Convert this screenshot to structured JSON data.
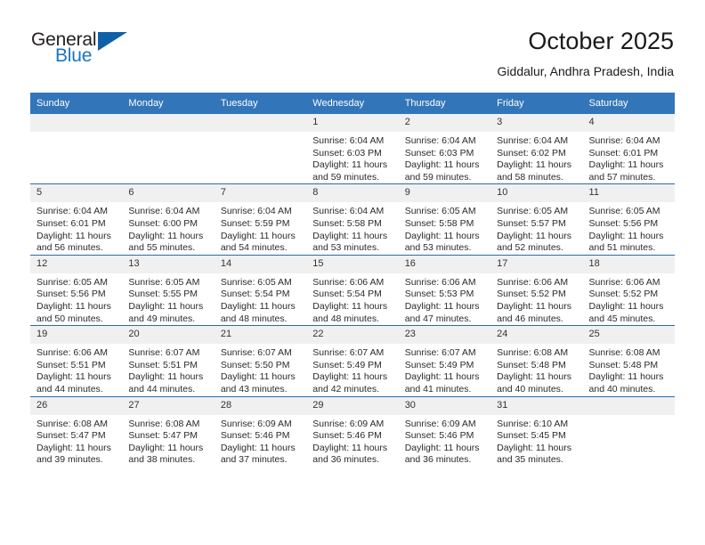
{
  "brand": {
    "name_top": "General",
    "name_bottom": "Blue",
    "color_dark": "#231f20",
    "color_blue": "#1c75bc",
    "triangle_color": "#1060a8"
  },
  "header": {
    "title": "October 2025",
    "subtitle": "Giddalur, Andhra Pradesh, India"
  },
  "theme": {
    "header_row_bg": "#3275b9",
    "week_rule": "#2d6ca8",
    "daynum_bg": "#f0f0f0"
  },
  "weekdays": [
    "Sunday",
    "Monday",
    "Tuesday",
    "Wednesday",
    "Thursday",
    "Friday",
    "Saturday"
  ],
  "weeks": [
    [
      {
        "day": "",
        "blank": true,
        "sunrise": "",
        "sunset": "",
        "daylight1": "",
        "daylight2": ""
      },
      {
        "day": "",
        "blank": true,
        "sunrise": "",
        "sunset": "",
        "daylight1": "",
        "daylight2": ""
      },
      {
        "day": "",
        "blank": true,
        "sunrise": "",
        "sunset": "",
        "daylight1": "",
        "daylight2": ""
      },
      {
        "day": "1",
        "sunrise": "Sunrise: 6:04 AM",
        "sunset": "Sunset: 6:03 PM",
        "daylight1": "Daylight: 11 hours",
        "daylight2": "and 59 minutes."
      },
      {
        "day": "2",
        "sunrise": "Sunrise: 6:04 AM",
        "sunset": "Sunset: 6:03 PM",
        "daylight1": "Daylight: 11 hours",
        "daylight2": "and 59 minutes."
      },
      {
        "day": "3",
        "sunrise": "Sunrise: 6:04 AM",
        "sunset": "Sunset: 6:02 PM",
        "daylight1": "Daylight: 11 hours",
        "daylight2": "and 58 minutes."
      },
      {
        "day": "4",
        "sunrise": "Sunrise: 6:04 AM",
        "sunset": "Sunset: 6:01 PM",
        "daylight1": "Daylight: 11 hours",
        "daylight2": "and 57 minutes."
      }
    ],
    [
      {
        "day": "5",
        "sunrise": "Sunrise: 6:04 AM",
        "sunset": "Sunset: 6:01 PM",
        "daylight1": "Daylight: 11 hours",
        "daylight2": "and 56 minutes."
      },
      {
        "day": "6",
        "sunrise": "Sunrise: 6:04 AM",
        "sunset": "Sunset: 6:00 PM",
        "daylight1": "Daylight: 11 hours",
        "daylight2": "and 55 minutes."
      },
      {
        "day": "7",
        "sunrise": "Sunrise: 6:04 AM",
        "sunset": "Sunset: 5:59 PM",
        "daylight1": "Daylight: 11 hours",
        "daylight2": "and 54 minutes."
      },
      {
        "day": "8",
        "sunrise": "Sunrise: 6:04 AM",
        "sunset": "Sunset: 5:58 PM",
        "daylight1": "Daylight: 11 hours",
        "daylight2": "and 53 minutes."
      },
      {
        "day": "9",
        "sunrise": "Sunrise: 6:05 AM",
        "sunset": "Sunset: 5:58 PM",
        "daylight1": "Daylight: 11 hours",
        "daylight2": "and 53 minutes."
      },
      {
        "day": "10",
        "sunrise": "Sunrise: 6:05 AM",
        "sunset": "Sunset: 5:57 PM",
        "daylight1": "Daylight: 11 hours",
        "daylight2": "and 52 minutes."
      },
      {
        "day": "11",
        "sunrise": "Sunrise: 6:05 AM",
        "sunset": "Sunset: 5:56 PM",
        "daylight1": "Daylight: 11 hours",
        "daylight2": "and 51 minutes."
      }
    ],
    [
      {
        "day": "12",
        "sunrise": "Sunrise: 6:05 AM",
        "sunset": "Sunset: 5:56 PM",
        "daylight1": "Daylight: 11 hours",
        "daylight2": "and 50 minutes."
      },
      {
        "day": "13",
        "sunrise": "Sunrise: 6:05 AM",
        "sunset": "Sunset: 5:55 PM",
        "daylight1": "Daylight: 11 hours",
        "daylight2": "and 49 minutes."
      },
      {
        "day": "14",
        "sunrise": "Sunrise: 6:05 AM",
        "sunset": "Sunset: 5:54 PM",
        "daylight1": "Daylight: 11 hours",
        "daylight2": "and 48 minutes."
      },
      {
        "day": "15",
        "sunrise": "Sunrise: 6:06 AM",
        "sunset": "Sunset: 5:54 PM",
        "daylight1": "Daylight: 11 hours",
        "daylight2": "and 48 minutes."
      },
      {
        "day": "16",
        "sunrise": "Sunrise: 6:06 AM",
        "sunset": "Sunset: 5:53 PM",
        "daylight1": "Daylight: 11 hours",
        "daylight2": "and 47 minutes."
      },
      {
        "day": "17",
        "sunrise": "Sunrise: 6:06 AM",
        "sunset": "Sunset: 5:52 PM",
        "daylight1": "Daylight: 11 hours",
        "daylight2": "and 46 minutes."
      },
      {
        "day": "18",
        "sunrise": "Sunrise: 6:06 AM",
        "sunset": "Sunset: 5:52 PM",
        "daylight1": "Daylight: 11 hours",
        "daylight2": "and 45 minutes."
      }
    ],
    [
      {
        "day": "19",
        "sunrise": "Sunrise: 6:06 AM",
        "sunset": "Sunset: 5:51 PM",
        "daylight1": "Daylight: 11 hours",
        "daylight2": "and 44 minutes."
      },
      {
        "day": "20",
        "sunrise": "Sunrise: 6:07 AM",
        "sunset": "Sunset: 5:51 PM",
        "daylight1": "Daylight: 11 hours",
        "daylight2": "and 44 minutes."
      },
      {
        "day": "21",
        "sunrise": "Sunrise: 6:07 AM",
        "sunset": "Sunset: 5:50 PM",
        "daylight1": "Daylight: 11 hours",
        "daylight2": "and 43 minutes."
      },
      {
        "day": "22",
        "sunrise": "Sunrise: 6:07 AM",
        "sunset": "Sunset: 5:49 PM",
        "daylight1": "Daylight: 11 hours",
        "daylight2": "and 42 minutes."
      },
      {
        "day": "23",
        "sunrise": "Sunrise: 6:07 AM",
        "sunset": "Sunset: 5:49 PM",
        "daylight1": "Daylight: 11 hours",
        "daylight2": "and 41 minutes."
      },
      {
        "day": "24",
        "sunrise": "Sunrise: 6:08 AM",
        "sunset": "Sunset: 5:48 PM",
        "daylight1": "Daylight: 11 hours",
        "daylight2": "and 40 minutes."
      },
      {
        "day": "25",
        "sunrise": "Sunrise: 6:08 AM",
        "sunset": "Sunset: 5:48 PM",
        "daylight1": "Daylight: 11 hours",
        "daylight2": "and 40 minutes."
      }
    ],
    [
      {
        "day": "26",
        "sunrise": "Sunrise: 6:08 AM",
        "sunset": "Sunset: 5:47 PM",
        "daylight1": "Daylight: 11 hours",
        "daylight2": "and 39 minutes."
      },
      {
        "day": "27",
        "sunrise": "Sunrise: 6:08 AM",
        "sunset": "Sunset: 5:47 PM",
        "daylight1": "Daylight: 11 hours",
        "daylight2": "and 38 minutes."
      },
      {
        "day": "28",
        "sunrise": "Sunrise: 6:09 AM",
        "sunset": "Sunset: 5:46 PM",
        "daylight1": "Daylight: 11 hours",
        "daylight2": "and 37 minutes."
      },
      {
        "day": "29",
        "sunrise": "Sunrise: 6:09 AM",
        "sunset": "Sunset: 5:46 PM",
        "daylight1": "Daylight: 11 hours",
        "daylight2": "and 36 minutes."
      },
      {
        "day": "30",
        "sunrise": "Sunrise: 6:09 AM",
        "sunset": "Sunset: 5:46 PM",
        "daylight1": "Daylight: 11 hours",
        "daylight2": "and 36 minutes."
      },
      {
        "day": "31",
        "sunrise": "Sunrise: 6:10 AM",
        "sunset": "Sunset: 5:45 PM",
        "daylight1": "Daylight: 11 hours",
        "daylight2": "and 35 minutes."
      },
      {
        "day": "",
        "blank": true,
        "sunrise": "",
        "sunset": "",
        "daylight1": "",
        "daylight2": ""
      }
    ]
  ]
}
